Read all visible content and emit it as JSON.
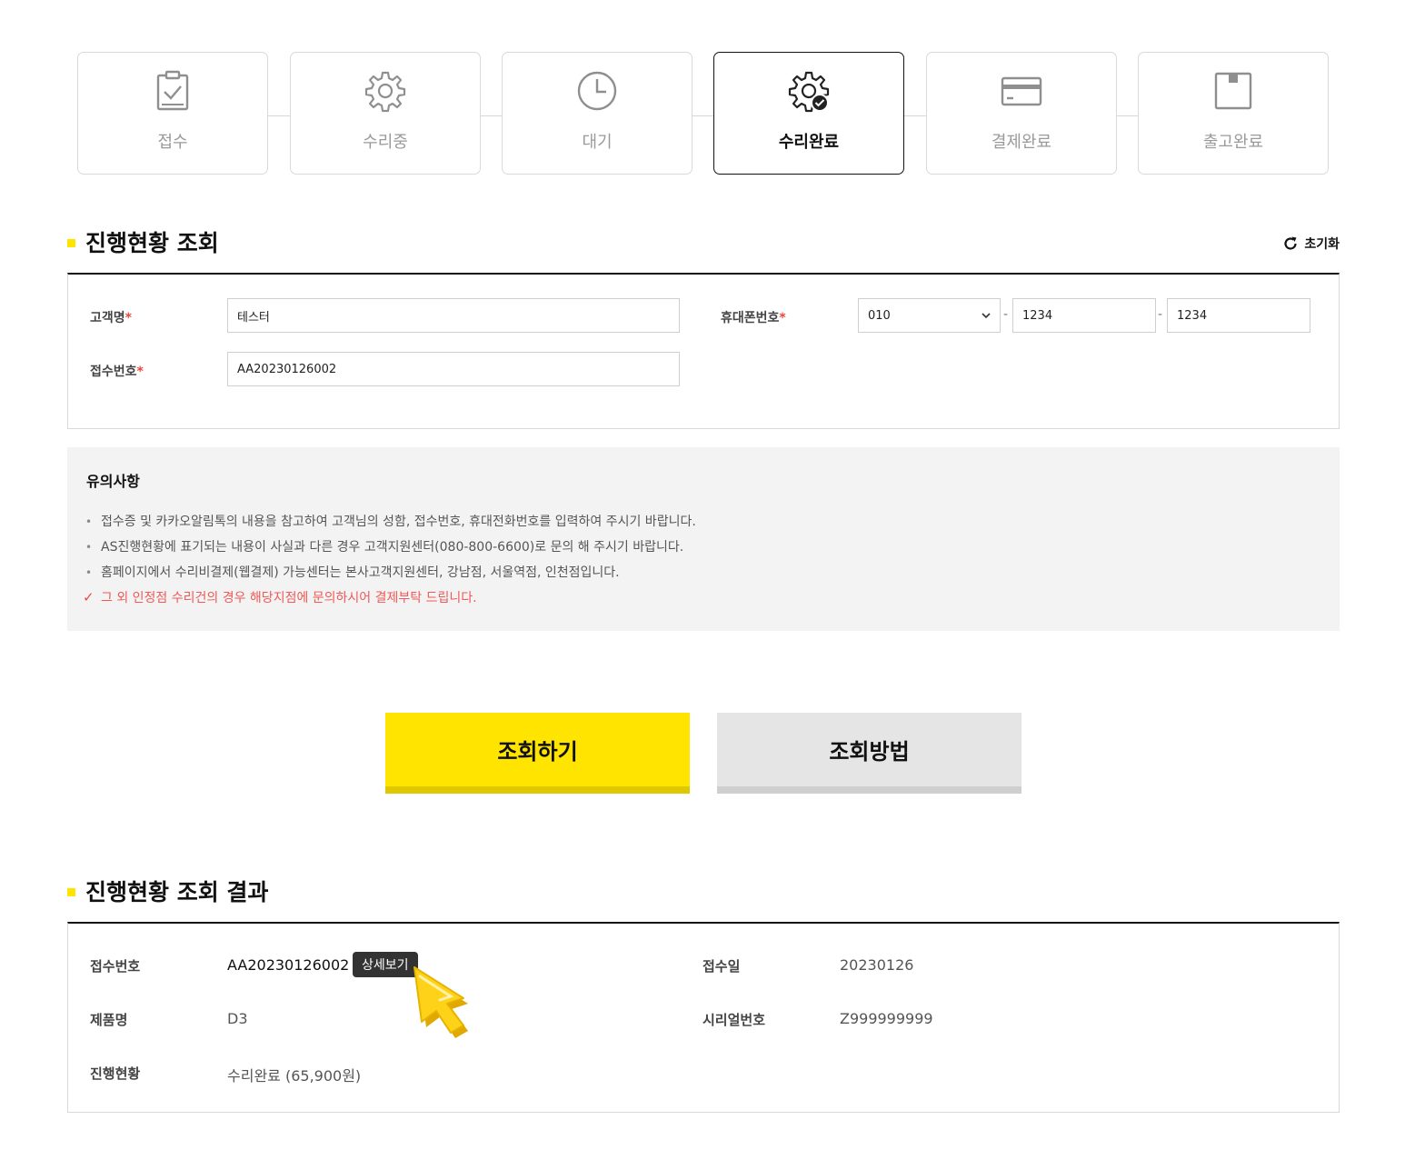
{
  "steps": [
    {
      "label": "접수",
      "icon": "clipboard-check-icon",
      "active": false
    },
    {
      "label": "수리중",
      "icon": "gear-icon",
      "active": false
    },
    {
      "label": "대기",
      "icon": "clock-icon",
      "active": false
    },
    {
      "label": "수리완료",
      "icon": "gear-check-icon",
      "active": true
    },
    {
      "label": "결제완료",
      "icon": "credit-card-icon",
      "active": false
    },
    {
      "label": "출고완료",
      "icon": "box-icon",
      "active": false
    }
  ],
  "search": {
    "title": "진행현황 조회",
    "reset_label": "초기화",
    "customer_label": "고객명",
    "customer_value": "테스터",
    "phone_label": "휴대폰번호",
    "phone_prefix": "010",
    "phone_mid": "1234",
    "phone_last": "1234",
    "receipt_label": "접수번호",
    "receipt_value": "AA20230126002",
    "required_mark": "*"
  },
  "notice": {
    "title": "유의사항",
    "items": [
      "접수증 및 카카오알림톡의 내용을 참고하여 고객님의 성함, 접수번호, 휴대전화번호를 입력하여 주시기 바랍니다.",
      "AS진행현황에 표기되는 내용이 사실과 다른 경우 고객지원센터(080-800-6600)로 문의 해 주시기 바랍니다.",
      "홈페이지에서 수리비결제(웹결제) 가능센터는 본사고객지원센터, 강남점, 서울역점, 인천점입니다."
    ],
    "warning": "그 외 인정점 수리건의 경우 해당지점에 문의하시어 결제부탁 드립니다.",
    "bullet": "•",
    "check": "✓"
  },
  "buttons": {
    "search": "조회하기",
    "howto": "조회방법"
  },
  "result": {
    "title": "진행현황 조회 결과",
    "receipt_label": "접수번호",
    "receipt_value": "AA20230126002",
    "detail_label": "상세보기",
    "date_label": "접수일",
    "date_value": "20230126",
    "product_label": "제품명",
    "product_value": "D3",
    "serial_label": "시리얼번호",
    "serial_value": "Z999999999",
    "status_label": "진행현황",
    "status_value": "수리완료 (65,900원)"
  },
  "colors": {
    "accent": "#ffe400",
    "warning": "#ee5a57",
    "active_border": "#111111"
  }
}
